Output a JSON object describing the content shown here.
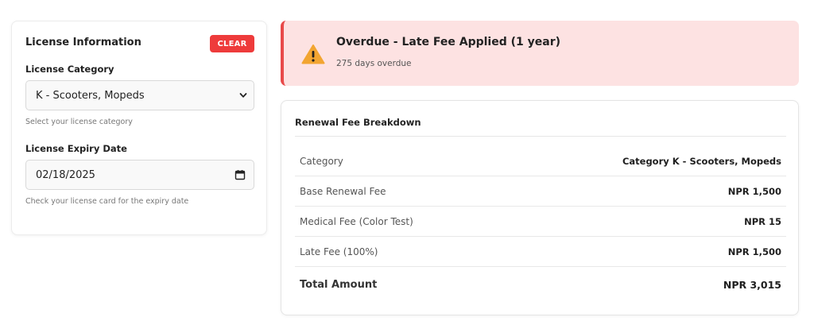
{
  "license_form": {
    "title": "License Information",
    "clear_label": "CLEAR",
    "category": {
      "label": "License Category",
      "value": "K - Scooters, Mopeds",
      "hint": "Select your license category"
    },
    "expiry": {
      "label": "License Expiry Date",
      "value": "02/18/2025",
      "hint": "Check your license card for the expiry date"
    }
  },
  "alert": {
    "title": "Overdue - Late Fee Applied (1 year)",
    "subtitle": "275 days overdue",
    "icon": "warning-icon",
    "background": "#fde2e2",
    "accent": "#e84a4a"
  },
  "fee_breakdown": {
    "title": "Renewal Fee Breakdown",
    "rows": [
      {
        "label": "Category",
        "value": "Category K - Scooters, Mopeds"
      },
      {
        "label": "Base Renewal Fee",
        "value": "NPR 1,500"
      },
      {
        "label": "Medical Fee (Color Test)",
        "value": "NPR 15"
      },
      {
        "label": "Late Fee (100%)",
        "value": "NPR 1,500"
      }
    ],
    "total": {
      "label": "Total Amount",
      "value": "NPR 3,015"
    }
  },
  "colors": {
    "clear_button": "#ee3b3b",
    "warning_icon": "#f2a531"
  }
}
